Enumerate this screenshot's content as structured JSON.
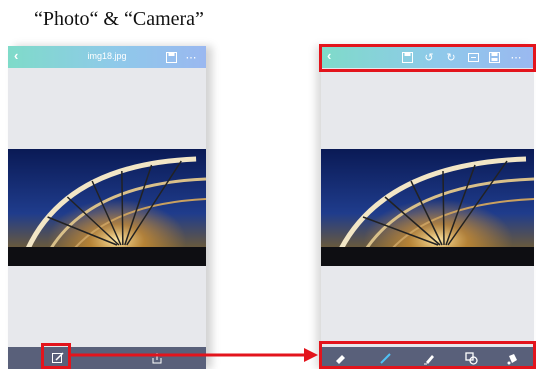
{
  "caption": "“Photo“ & “Camera”",
  "left_screen": {
    "back_icon": "chevron-left",
    "title": "img18.jpg",
    "top_icons": [
      "save-icon",
      "more-icon"
    ],
    "bottom_icons": [
      "edit-icon",
      "share-icon"
    ]
  },
  "right_screen": {
    "back_icon": "chevron-left",
    "top_icons": [
      "save-icon",
      "undo-icon",
      "redo-icon",
      "crop-icon",
      "export-icon",
      "more-icon"
    ],
    "bottom_icons": [
      "eraser-icon",
      "brush-icon",
      "highlighter-icon",
      "shape-icon",
      "fill-icon"
    ]
  },
  "colors": {
    "highlight": "#e3141c",
    "top_bar": "#8fc9ea",
    "bottom_bar": "#59607a",
    "screen_bg": "#e7e8ec"
  }
}
